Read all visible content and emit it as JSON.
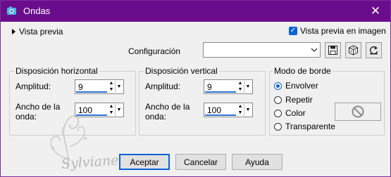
{
  "window": {
    "title": "Ondas"
  },
  "preview": {
    "expand_label": "Vista previa",
    "checkbox_label": "Vista previa en imagen",
    "checked": true
  },
  "config": {
    "label": "Configuración",
    "value": ""
  },
  "horizontal": {
    "title": "Disposición horizontal",
    "amp_label": "Amplitud:",
    "amp_value": "9",
    "wave_label_1": "Ancho de la",
    "wave_label_2": "onda:",
    "wave_value": "100"
  },
  "vertical": {
    "title": "Disposición vertical",
    "amp_label": "Amplitud:",
    "amp_value": "9",
    "wave_label_1": "Ancho de la",
    "wave_label_2": "onda:",
    "wave_value": "100"
  },
  "edge": {
    "title": "Modo de borde",
    "options": [
      "Envolver",
      "Repetir",
      "Color",
      "Transparente"
    ],
    "selected": "Envolver"
  },
  "buttons": {
    "ok": "Aceptar",
    "cancel": "Cancelar",
    "help": "Ayuda"
  },
  "watermark": "Sylviane",
  "colors": {
    "titlebar": "#6a0d8d",
    "accent": "#0a64d6"
  }
}
